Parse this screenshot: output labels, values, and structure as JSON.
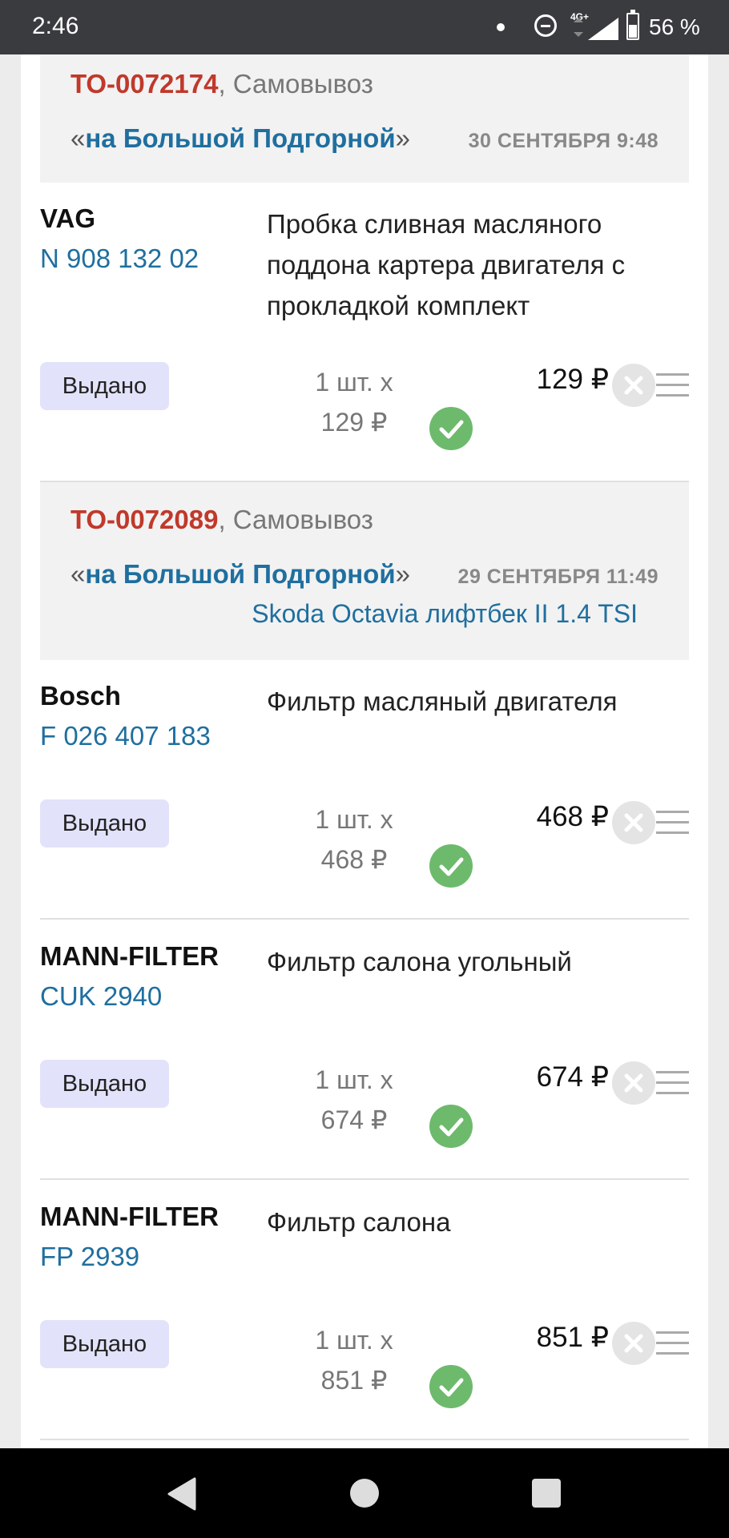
{
  "status_bar": {
    "time": "2:46",
    "network": "4G+",
    "battery": "56 %"
  },
  "orders": [
    {
      "id": "ТО-0072174",
      "delivery": ", Самовывоз",
      "store_open_quote": "«",
      "store": "на Большой Подгорной",
      "store_close_quote": "»",
      "date": "30 СЕНТЯБРЯ 9:48",
      "items": [
        {
          "brand": "VAG",
          "article": "N 908 132 02",
          "description": "Пробка сливная масляного поддона картера двигателя с прокладкой комплект",
          "status": "Выдано",
          "qty": "1 шт. x",
          "unit_price": "129 ₽",
          "price": "129 ₽"
        }
      ]
    },
    {
      "id": "ТО-0072089",
      "delivery": ", Самовывоз",
      "store_open_quote": "«",
      "store": "на Большой Подгорной",
      "store_close_quote": "»",
      "date": "29 СЕНТЯБРЯ 11:49",
      "car": "Skoda Octavia лифтбек II 1.4 TSI",
      "items": [
        {
          "brand": "Bosch",
          "article": "F 026 407 183",
          "description": "Фильтр масляный двигателя",
          "status": "Выдано",
          "qty": "1 шт. x",
          "unit_price": "468 ₽",
          "price": "468 ₽"
        },
        {
          "brand": "MANN-FILTER",
          "article": "CUK 2940",
          "description": "Фильтр салона угольный",
          "status": "Выдано",
          "qty": "1 шт. x",
          "unit_price": "674 ₽",
          "price": "674 ₽"
        },
        {
          "brand": "MANN-FILTER",
          "article": "FP 2939",
          "description": "Фильтр салона",
          "status": "Выдано",
          "qty": "1 шт. x",
          "unit_price": "851 ₽",
          "price": "851 ₽"
        }
      ]
    }
  ],
  "icons": {
    "check": "check-circle-icon",
    "remove": "remove-circle-icon",
    "menu": "menu-icon"
  },
  "colors": {
    "order_id": "#c0392b",
    "link": "#1f6f9f",
    "status_badge": "#e2e2fb",
    "check": "#6dba6d"
  }
}
